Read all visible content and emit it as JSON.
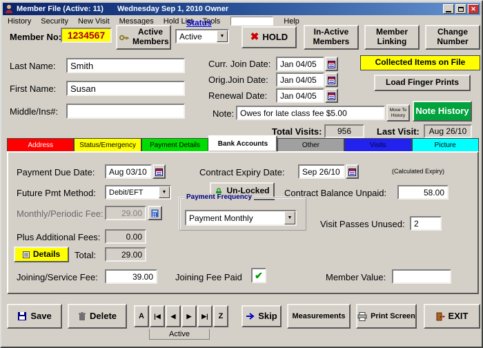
{
  "titlebar": {
    "title": "Member File (Active: 11)",
    "datetime": "Wednesday   Sep 1, 2010  Owner"
  },
  "menu": {
    "items": [
      "History",
      "Security",
      "New Visit",
      "Messages",
      "Hold List",
      "Tools"
    ],
    "help": "Help"
  },
  "icons": {
    "dropdown": "▼",
    "close": "✕",
    "hold_x": "✖",
    "check": "✔"
  },
  "colors": {
    "member_no_bg": "#ffff00",
    "member_no_text": "#aa0000",
    "hold_red": "#cc0000",
    "note_history_bg": "#00a33d",
    "collected_bg": "#ffff00",
    "details_bg": "#ffff00",
    "status_label": "#0000cc",
    "check_green": "#009900"
  },
  "header": {
    "member_no_label": "Member No:",
    "member_no_value": "1234567",
    "active_members": "Active Members",
    "status_label": "Status",
    "status_value": "Active",
    "hold": "HOLD",
    "inactive_members": "In-Active Members",
    "member_linking": "Member Linking",
    "change_number": "Change Number"
  },
  "personal": {
    "last_name_label": "Last Name:",
    "last_name": "Smith",
    "first_name_label": "First Name:",
    "first_name": "Susan",
    "middle_label": "Middle/Ins#:",
    "middle": ""
  },
  "dates": {
    "curr_join_label": "Curr. Join Date:",
    "curr_join": "Jan 04/05",
    "orig_join_label": "Orig.Join Date:",
    "orig_join": "Jan 04/05",
    "renewal_label": "Renewal Date:",
    "renewal": "Jan 04/05",
    "note_label": "Note:",
    "note": "Owes for late class fee $5.00",
    "collected_items": "Collected Items on File",
    "load_fingerprints": "Load Finger Prints",
    "move_to_history": "Move To History",
    "note_history": "Note History",
    "total_visits_label": "Total Visits:",
    "total_visits": "956",
    "last_visit_label": "Last Visit:",
    "last_visit": "Aug 26/10"
  },
  "tabs": [
    {
      "label": "Address",
      "bg": "#ff0000",
      "fg": "#ffffff"
    },
    {
      "label": "Status/Emergency",
      "bg": "#ffff00",
      "fg": "#000000"
    },
    {
      "label": "Payment Details",
      "bg": "#00dd00",
      "fg": "#000000"
    },
    {
      "label": "Bank Accounts",
      "bg": "#ffffff",
      "fg": "#000000"
    },
    {
      "label": "Other",
      "bg": "#a0a0a0",
      "fg": "#000000"
    },
    {
      "label": "Visits",
      "bg": "#2222ee",
      "fg": "#000040"
    },
    {
      "label": "Picture",
      "bg": "#00ffff",
      "fg": "#000000"
    }
  ],
  "payment": {
    "due_date_label": "Payment Due Date:",
    "due_date": "Aug 03/10",
    "expiry_label": "Contract Expiry Date:",
    "expiry": "Sep 26/10",
    "calculated_expiry": "(Calculated Expiry)",
    "future_pmt_label": "Future Pmt Method:",
    "future_pmt": "Debit/EFT",
    "unlocked": "Un-Locked",
    "balance_label": "Contract Balance Unpaid:",
    "balance": "58.00",
    "monthly_fee_label": "Monthly/Periodic Fee:",
    "monthly_fee": "29.00",
    "freq_group": "Payment Frequency",
    "freq_value": "Payment Monthly",
    "additional_label": "Plus Additional Fees:",
    "additional": "0.00",
    "passes_label": "Visit Passes Unused:",
    "passes": "2",
    "details": "Details",
    "total_label": "Total:",
    "total": "29.00",
    "joining_fee_label": "Joining/Service Fee:",
    "joining_fee": "39.00",
    "joining_paid_label": "Joining Fee Paid",
    "member_value_label": "Member Value:",
    "member_value": ""
  },
  "footer": {
    "save": "Save",
    "delete": "Delete",
    "nav": [
      "A",
      "|◀",
      "◀",
      "▶",
      "▶|",
      "Z"
    ],
    "skip": "Skip",
    "measurements": "Measurements",
    "print_screen": "Print Screen",
    "exit": "EXIT",
    "bottom_tab": "Active"
  }
}
